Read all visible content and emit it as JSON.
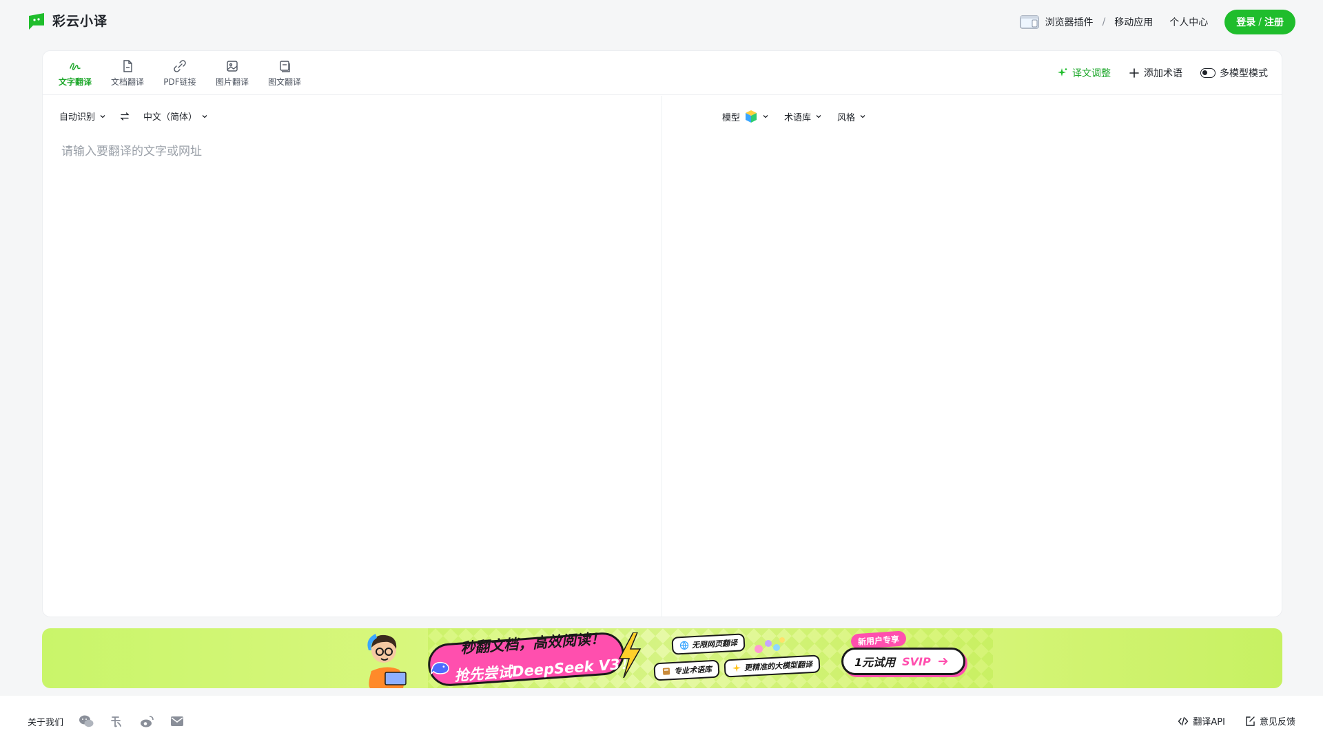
{
  "header": {
    "app_name": "彩云小译",
    "plugin_label": "浏览器插件",
    "plugin_sep": "/",
    "mobile_label": "移动应用",
    "personal_center": "个人中心",
    "login_label": "登录",
    "login_sep": "/",
    "register_label": "注册"
  },
  "tabs": [
    {
      "label": "文字翻译",
      "icon": "pen-icon",
      "active": true
    },
    {
      "label": "文档翻译",
      "icon": "document-icon",
      "active": false
    },
    {
      "label": "PDF链接",
      "icon": "link-icon",
      "active": false
    },
    {
      "label": "图片翻译",
      "icon": "image-icon",
      "active": false
    },
    {
      "label": "图文翻译",
      "icon": "image-text-icon",
      "active": false
    }
  ],
  "tools": {
    "adjust": "译文调整",
    "add_term": "添加术语",
    "multi_model": "多模型模式"
  },
  "source": {
    "from_lang": "自动识别",
    "to_lang": "中文（简体）",
    "placeholder": "请输入要翻译的文字或网址"
  },
  "target": {
    "model_label": "模型",
    "glossary_label": "术语库",
    "style_label": "风格"
  },
  "banner": {
    "line1": "秒翻文档，高效阅读！",
    "line2": "抢先尝试DeepSeek V3！",
    "chip1": "无限网页翻译",
    "chip2": "专业术语库",
    "chip3": "更精准的大模型翻译",
    "new_user_tag": "新用户专享",
    "cta_prefix": "1元试用",
    "cta_svip": "SVIP"
  },
  "footer": {
    "about": "关于我们",
    "api": "翻译API",
    "feedback": "意见反馈"
  },
  "colors": {
    "brand_green": "#1fbd2c",
    "active_green": "#1fa82c",
    "banner_pink": "#ff4fae"
  }
}
